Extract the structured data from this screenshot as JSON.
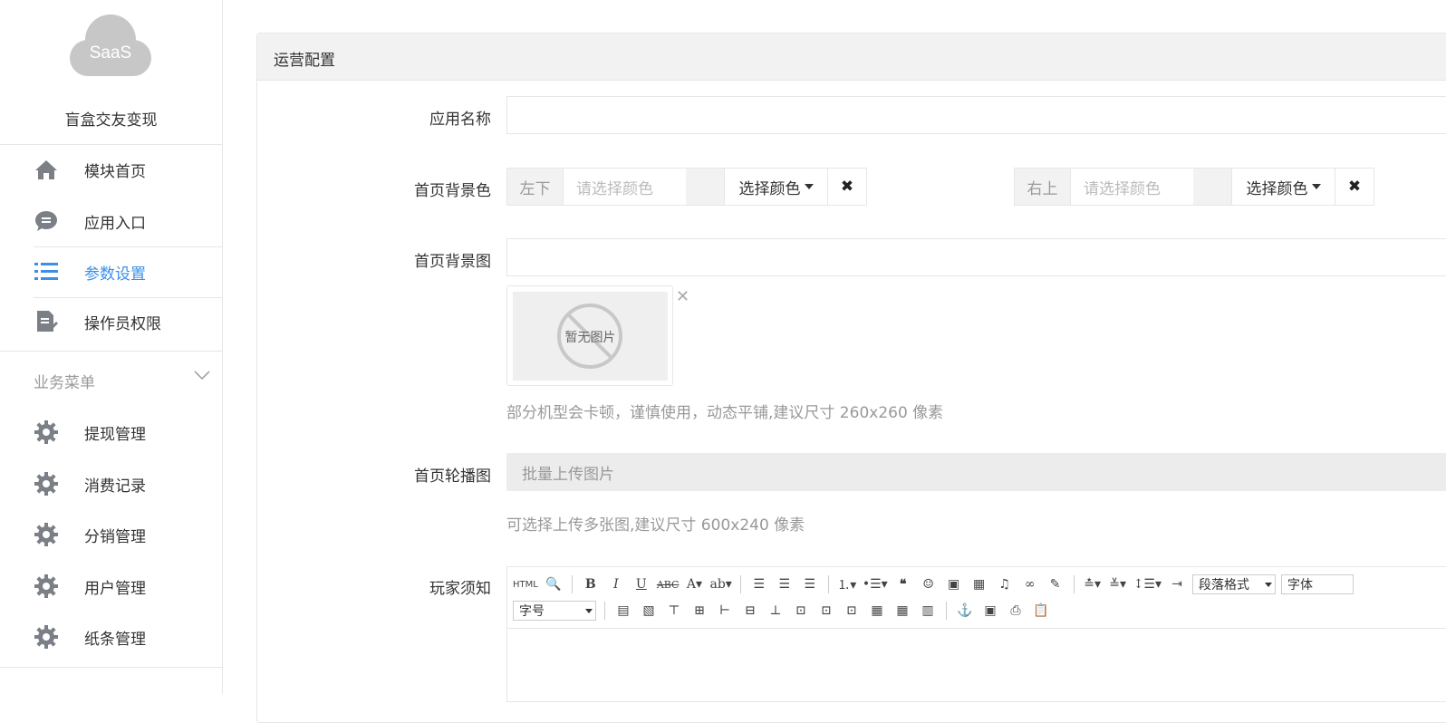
{
  "sidebar": {
    "logo_text": "SaaS",
    "app_name": "盲盒交友变现",
    "items": [
      {
        "label": "模块首页",
        "icon": "home-icon"
      },
      {
        "label": "应用入口",
        "icon": "chat-icon"
      },
      {
        "label": "参数设置",
        "icon": "list-icon",
        "active": true
      },
      {
        "label": "操作员权限",
        "icon": "document-edit-icon"
      }
    ],
    "group_title": "业务菜单",
    "group_items": [
      {
        "label": "提现管理",
        "icon": "gear-icon"
      },
      {
        "label": "消费记录",
        "icon": "gear-icon"
      },
      {
        "label": "分销管理",
        "icon": "gear-icon"
      },
      {
        "label": "用户管理",
        "icon": "gear-icon"
      },
      {
        "label": "纸条管理",
        "icon": "gear-icon"
      }
    ]
  },
  "panel": {
    "title": "运营配置",
    "fields": {
      "app_name_label": "应用名称",
      "app_name_value": "",
      "bg_color_label": "首页背景色",
      "bg_image_label": "首页背景图",
      "bg_image_value": "",
      "carousel_label": "首页轮播图",
      "notice_label": "玩家须知"
    },
    "color_pickers": [
      {
        "prefix": "左下",
        "placeholder": "请选择颜色",
        "button": "选择颜色"
      },
      {
        "prefix": "右上",
        "placeholder": "请选择颜色",
        "button": "选择颜色"
      }
    ],
    "no_image_text": "暂无图片",
    "bg_image_hint": "部分机型会卡顿，谨慎使用，动态平铺,建议尺寸 260x260 像素",
    "upload_button": "批量上传图片",
    "carousel_hint": "可选择上传多张图,建议尺寸 600x240 像素",
    "editor": {
      "html_label": "HTML",
      "paragraph_format": "段落格式",
      "font_family": "字体",
      "font_size": "字号"
    }
  },
  "colors": {
    "accent": "#3b8fe8",
    "border": "#e6e6e6",
    "header_bg": "#f2f2f2"
  }
}
